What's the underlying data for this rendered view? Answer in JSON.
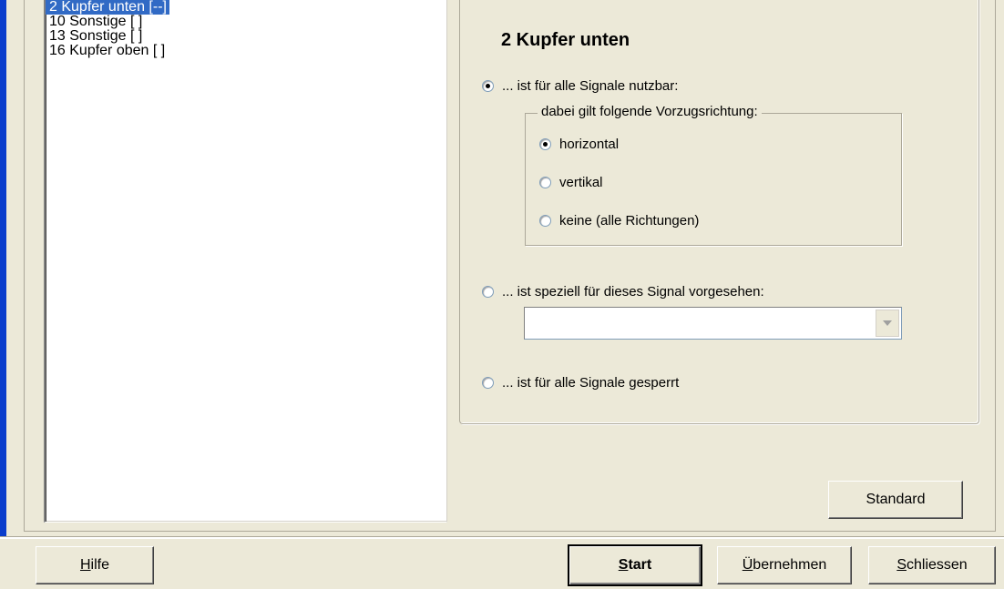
{
  "layers_list": {
    "items": [
      "2 Kupfer unten [--]",
      "10 Sonstige [ ]",
      "13 Sonstige [ ]",
      "16 Kupfer oben [ ]"
    ],
    "selected_index": 0
  },
  "detail": {
    "title": "2  Kupfer unten",
    "option_all_signals": "... ist für alle Signale nutzbar:",
    "direction_group_label": "dabei gilt folgende Vorzugsrichtung:",
    "direction_horizontal": "horizontal",
    "direction_vertical": "vertikal",
    "direction_none": "keine (alle Richtungen)",
    "option_special_signal": "... ist speziell für dieses Signal vorgesehen:",
    "signal_select_value": "",
    "option_blocked": "... ist für alle Signale gesperrt",
    "selected_usage": "all_signals",
    "selected_direction": "horizontal"
  },
  "buttons": {
    "standard": "Standard",
    "help_mnemonic": "H",
    "help_rest": "ilfe",
    "start_mnemonic": "S",
    "start_rest": "tart",
    "apply_mnemonic": "Ü",
    "apply_rest": "bernehmen",
    "close_mnemonic": "S",
    "close_rest": "chliessen"
  }
}
